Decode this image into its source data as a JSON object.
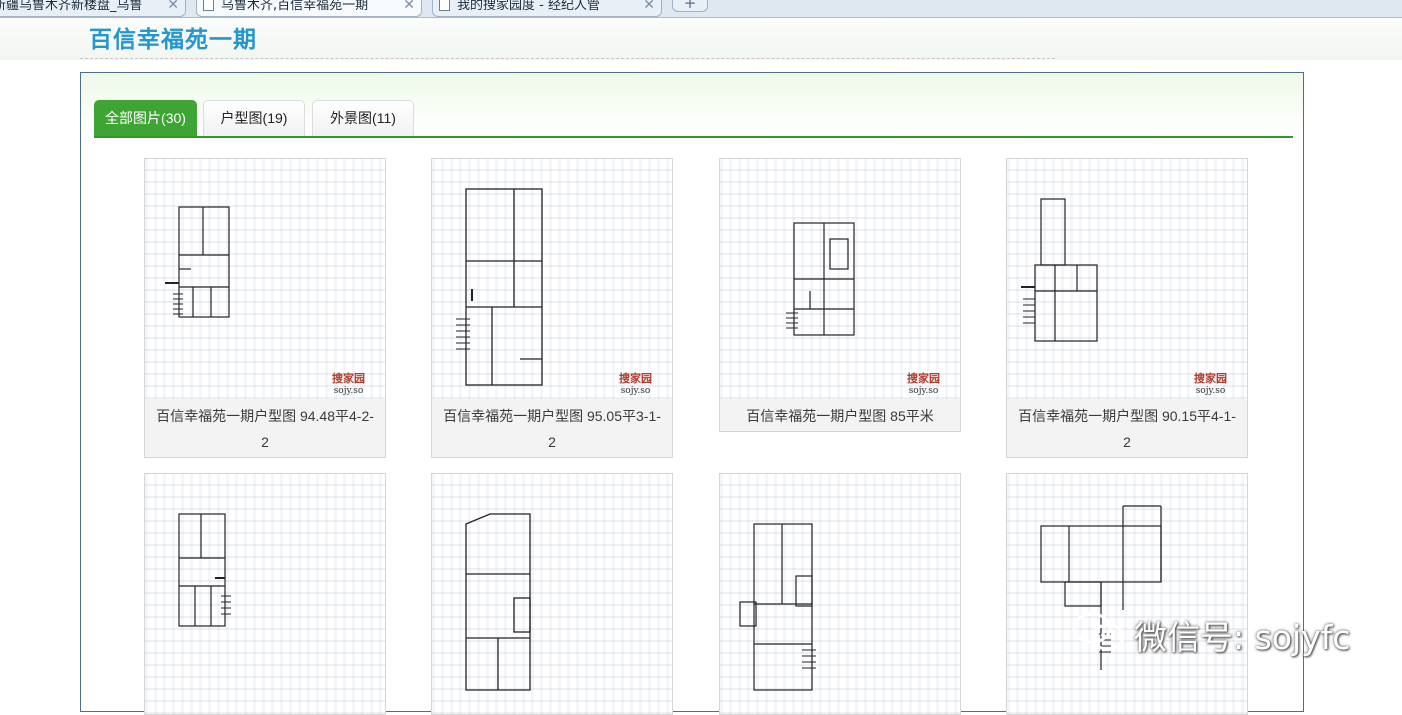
{
  "browser": {
    "tabs": [
      {
        "title": "新疆乌鲁木齐新楼盘_乌鲁"
      },
      {
        "title": "乌鲁木齐,百信幸福苑一期"
      },
      {
        "title": "我的搜家园度 - 经纪人管"
      }
    ],
    "new_tab_label": "+"
  },
  "page": {
    "title": "百信幸福苑一期"
  },
  "gallery": {
    "tabs": [
      {
        "label": "全部图片(30)"
      },
      {
        "label": "户型图(19)"
      },
      {
        "label": "外景图(11)"
      }
    ],
    "items": [
      {
        "caption": "百信幸福苑一期户型图 94.48平4-2-2"
      },
      {
        "caption": "百信幸福苑一期户型图 95.05平3-1-2"
      },
      {
        "caption": "百信幸福苑一期户型图 85平米"
      },
      {
        "caption": "百信幸福苑一期户型图 90.15平4-1-2"
      },
      {
        "caption": ""
      },
      {
        "caption": ""
      },
      {
        "caption": ""
      },
      {
        "caption": ""
      }
    ],
    "watermark": {
      "name": "搜家园",
      "domain": "sojy.so"
    }
  },
  "overlay": {
    "wechat_text": "微信号: sojyfc"
  }
}
